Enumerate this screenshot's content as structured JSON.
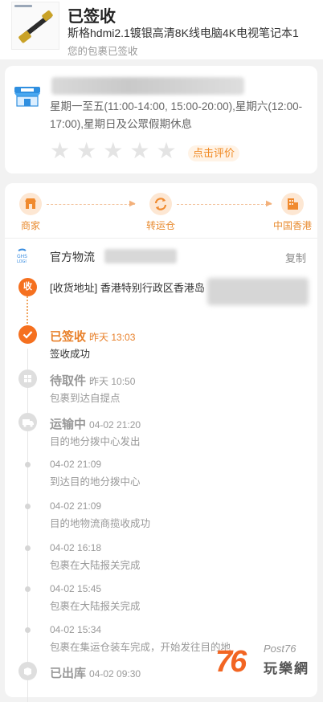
{
  "header": {
    "status_title": "已签收",
    "product_name": "斯格hdmi2.1镀银高清8K线电脑4K电视笔记本1",
    "status_sub": "您的包裹已签收"
  },
  "store": {
    "hours": "星期一至五(11:00-14:00, 15:00-20:00),星期六(12:00-17:00),星期日及公眾假期休息",
    "rating_stars": 0,
    "rate_button": "点击评价",
    "icon": "storefront-icon"
  },
  "route": {
    "nodes": [
      {
        "label": "商家",
        "icon": "shop-icon"
      },
      {
        "label": "转运仓",
        "icon": "transfer-icon"
      },
      {
        "label": "中国香港",
        "icon": "building-icon"
      }
    ]
  },
  "carrier": {
    "name": "官方物流",
    "copy_label": "复制"
  },
  "address": {
    "badge": "收",
    "text": "[收货地址] 香港特别行政区香港岛"
  },
  "events": [
    {
      "status": "已签收",
      "time": "昨天 13:03",
      "desc": "签收成功",
      "icon": "check-icon"
    },
    {
      "status": "待取件",
      "time": "昨天 10:50",
      "desc": "包裹到达自提点",
      "icon": "grid-icon"
    },
    {
      "status": "运输中",
      "time": "04-02 21:20",
      "desc": "目的地分拨中心发出",
      "icon": "truck-icon"
    },
    {
      "time": "04-02 21:09",
      "desc": "到达目的地分拨中心"
    },
    {
      "time": "04-02 21:09",
      "desc": "目的地物流商揽收成功"
    },
    {
      "time": "04-02 16:18",
      "desc": "包裹在大陆报关完成"
    },
    {
      "time": "04-02 15:45",
      "desc": "包裹在大陆报关完成"
    },
    {
      "time": "04-02 15:34",
      "desc": "包裹在集运仓装车完成，开始发往目的地"
    },
    {
      "status": "已出库",
      "time": "04-02 09:30",
      "desc": "",
      "icon": "box-icon"
    }
  ],
  "watermark": {
    "number": "76",
    "post": "Post76",
    "site": "玩樂網"
  },
  "colors": {
    "accent": "#f5701f",
    "accent_text": "#e8802a",
    "muted": "#999999"
  }
}
